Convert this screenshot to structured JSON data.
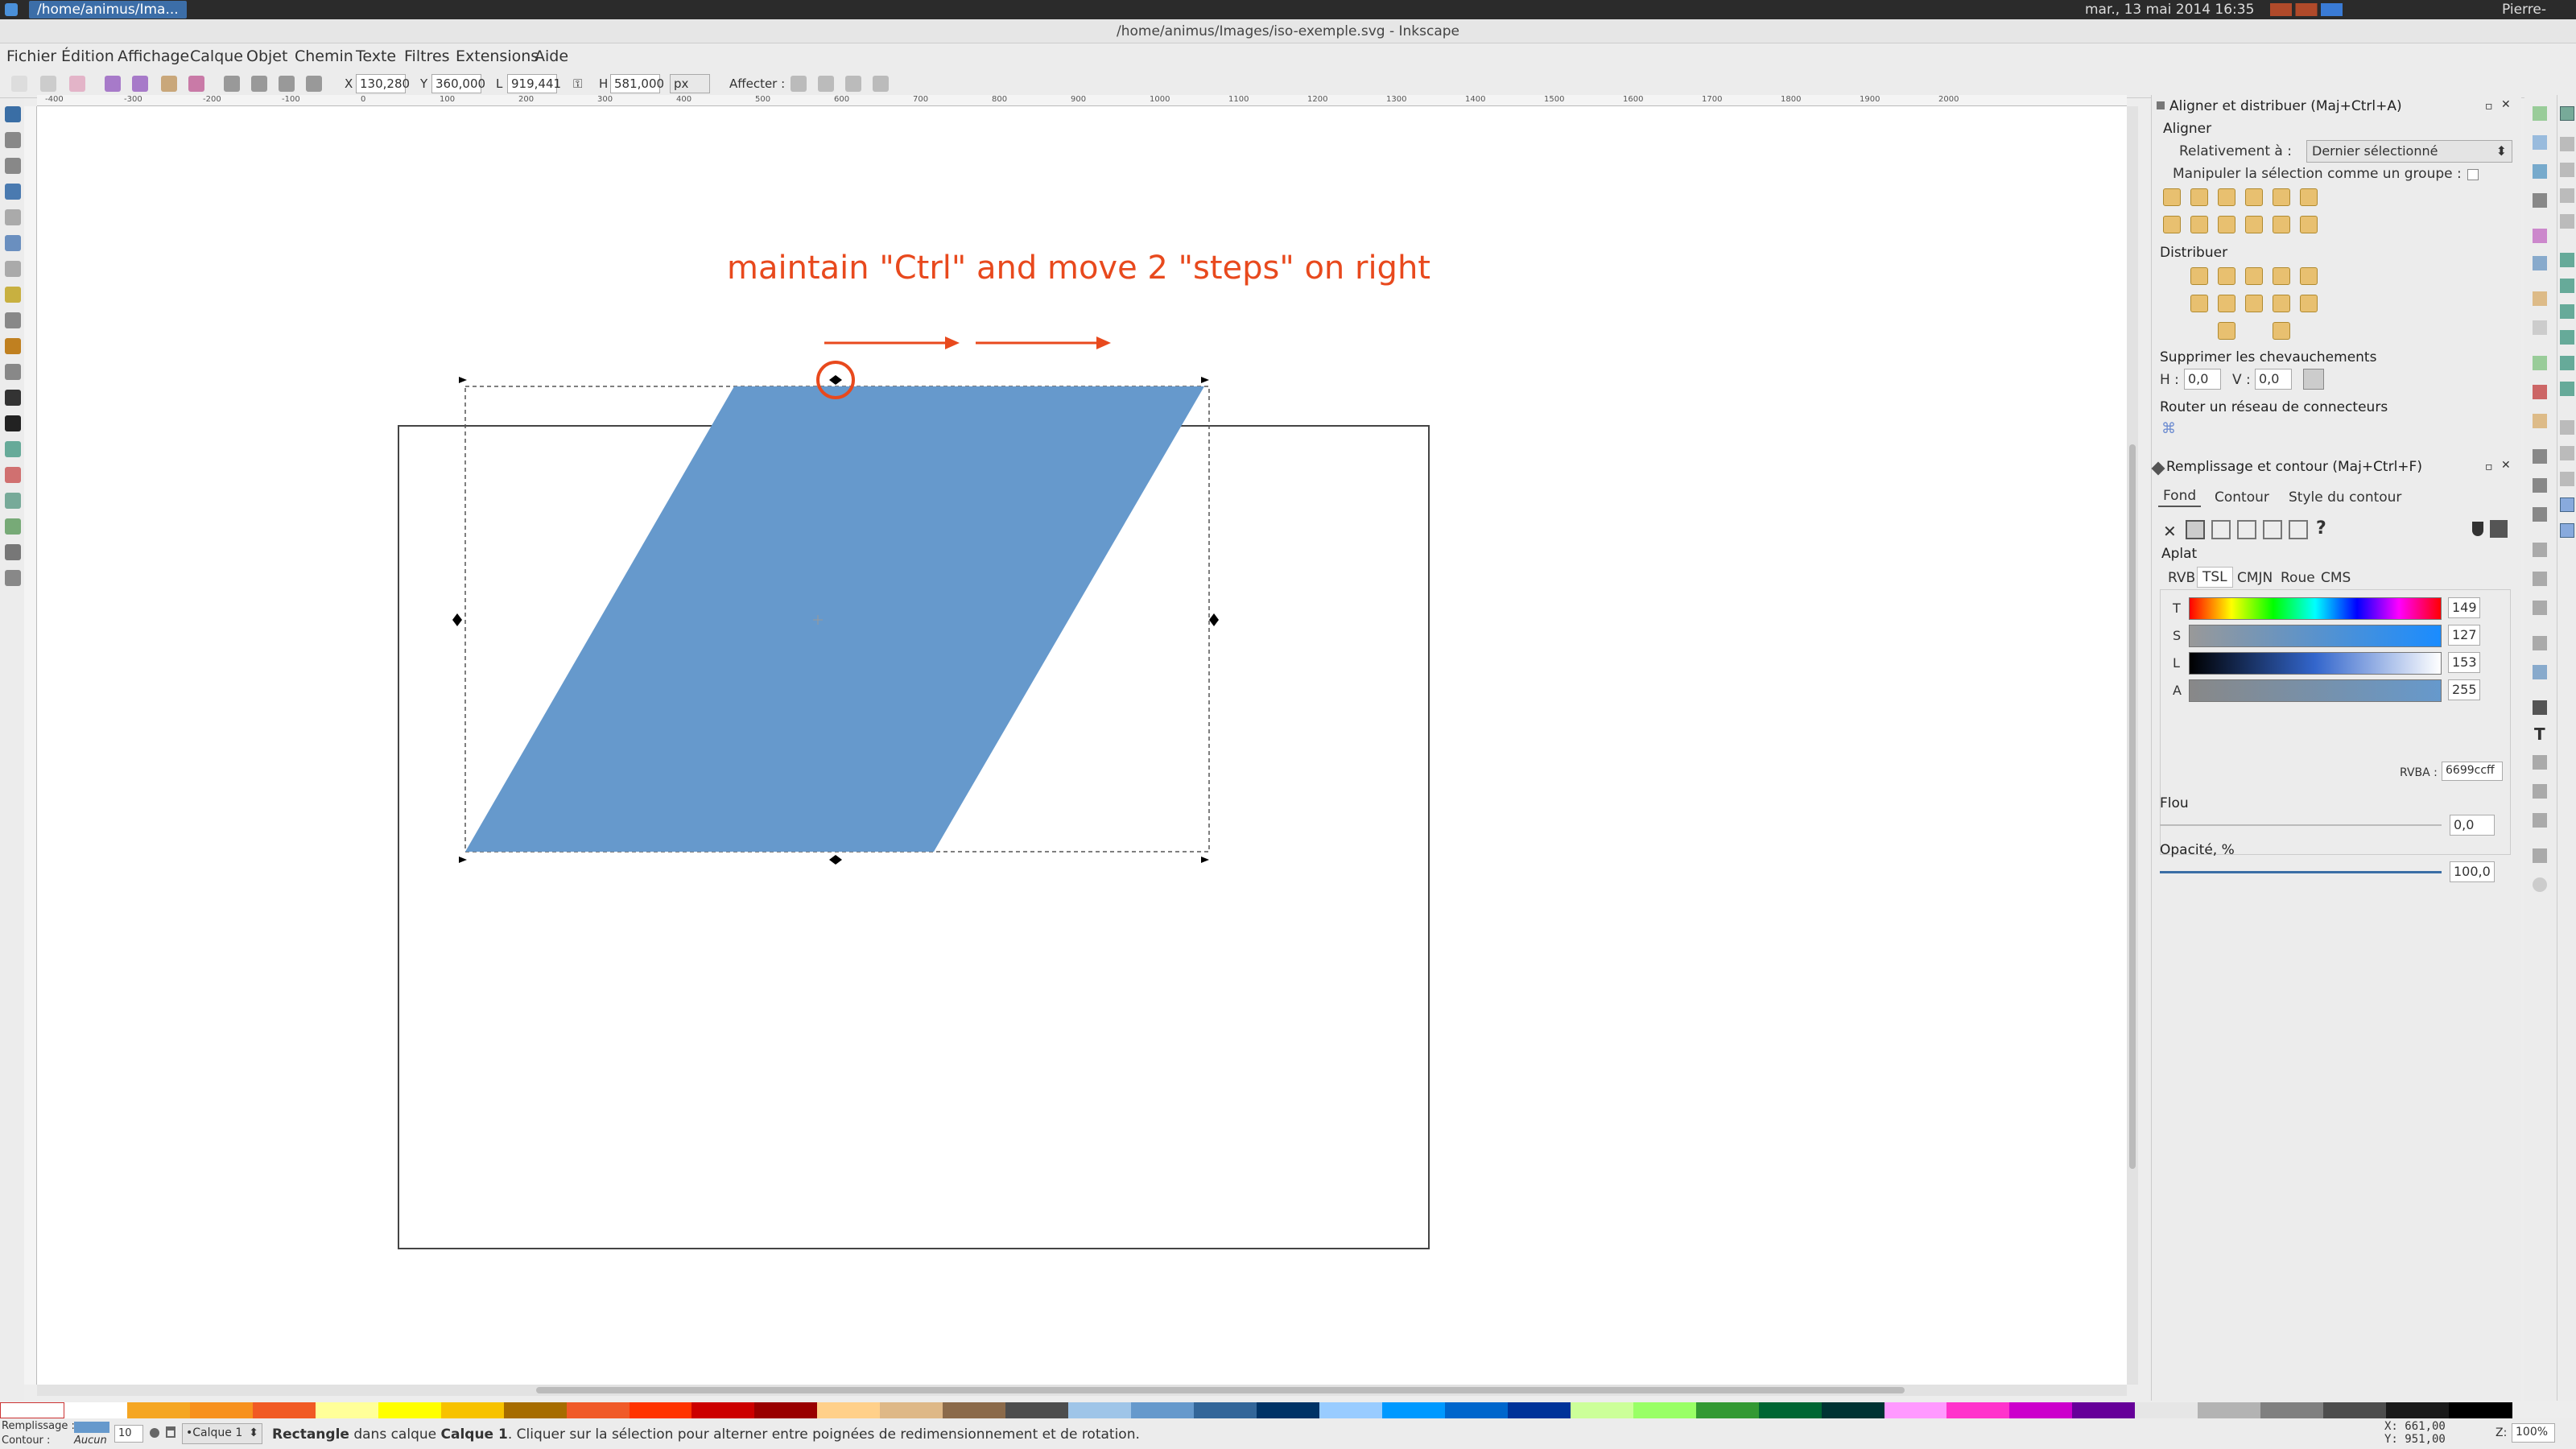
{
  "system": {
    "task": "/home/animus/Ima...",
    "clock": "mar., 13 mai 2014 16:35",
    "user": "Pierre-Jean"
  },
  "window": {
    "title": "/home/animus/Images/iso-exemple.svg - Inkscape"
  },
  "menu": [
    "Fichier",
    "Édition",
    "Affichage",
    "Calque",
    "Objet",
    "Chemin",
    "Texte",
    "Filtres",
    "Extensions",
    "Aide"
  ],
  "toolctrl": {
    "x_label": "X",
    "x_value": "130,280",
    "y_label": "Y",
    "y_value": "360,000",
    "w_label": "L",
    "w_value": "919,441",
    "h_label": "H",
    "h_value": "581,000",
    "unit": "px",
    "affect_label": "Affecter :"
  },
  "ruler": [
    "-400",
    "-300",
    "-200",
    "-100",
    "0",
    "100",
    "200",
    "300",
    "400",
    "500",
    "600",
    "700",
    "800",
    "900",
    "1000",
    "1100",
    "1200",
    "1300",
    "1400",
    "1500",
    "1600",
    "1700",
    "1800",
    "1900",
    "2000"
  ],
  "canvas": {
    "annotation": "maintain \"Ctrl\" and move 2 \"steps\" on right",
    "shape_color": "#6699cc",
    "annotation_color": "#e8491d"
  },
  "align": {
    "title": "Aligner et distribuer (Maj+Ctrl+A)",
    "align_label": "Aligner",
    "relative_label": "Relativement à :",
    "relative_value": "Dernier sélectionné",
    "group_label": "Manipuler la sélection comme un groupe :",
    "distribute_label": "Distribuer",
    "overlap_label": "Supprimer les chevauchements",
    "h_label": "H :",
    "h_value": "0,0",
    "v_label": "V :",
    "v_value": "0,0",
    "route_label": "Router un réseau de connecteurs"
  },
  "fill": {
    "title": "Remplissage et contour (Maj+Ctrl+F)",
    "tabs": [
      "Fond",
      "Contour",
      "Style du contour"
    ],
    "flat_label": "Aplat",
    "mode_tabs": [
      "RVB",
      "TSL",
      "CMJN",
      "Roue",
      "CMS"
    ],
    "channels": [
      {
        "label": "T",
        "value": "149"
      },
      {
        "label": "S",
        "value": "127"
      },
      {
        "label": "L",
        "value": "153"
      },
      {
        "label": "A",
        "value": "255"
      }
    ],
    "rgba_label": "RVBA :",
    "rgba_value": "6699ccff",
    "blur_label": "Flou",
    "blur_value": "0,0",
    "opacity_label": "Opacité, %",
    "opacity_value": "100,0"
  },
  "status": {
    "fill_label": "Remplissage :",
    "stroke_label": "Contour :",
    "stroke_value": "Aucun",
    "opacity_value": "10",
    "layer": "•Calque 1",
    "message_bold": "Rectangle",
    "message_mid": " dans calque ",
    "message_layer": "Calque 1",
    "message_rest": ". Cliquer sur la sélection pour alterner entre poignées de redimensionnement et de rotation.",
    "coords_x": "X: 661,00",
    "coords_y": "Y: 951,00",
    "zoom_label": "Z:",
    "zoom": "100%"
  },
  "palette_colors": [
    "#ffffff",
    "#f5a623",
    "#f7911e",
    "#f15a24",
    "#ffff99",
    "#ffff00",
    "#f7c200",
    "#a66c00",
    "#f05a28",
    "#ff3300",
    "#cc0000",
    "#990000",
    "#ffd08a",
    "#deb887",
    "#8b6a4a",
    "#4d4d4d",
    "#9fc5e8",
    "#6699cc",
    "#336699",
    "#003366",
    "#99ccff",
    "#0099ff",
    "#0066cc",
    "#003399",
    "#ccff99",
    "#99ff66",
    "#339933",
    "#006633",
    "#003333",
    "#ff99ff",
    "#ff33cc",
    "#cc00cc",
    "#660099",
    "#e6e6e6",
    "#b3b3b3",
    "#808080",
    "#4d4d4d",
    "#1a1a1a",
    "#000000"
  ]
}
